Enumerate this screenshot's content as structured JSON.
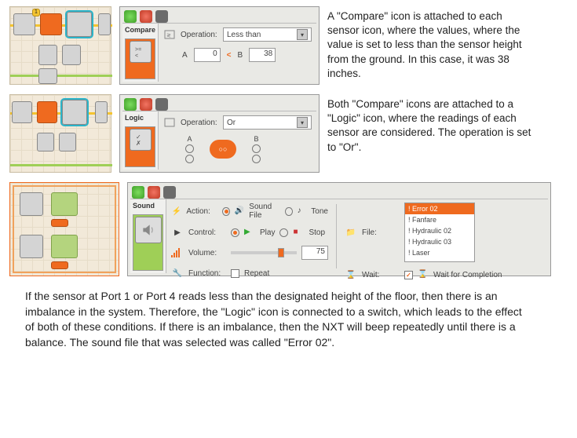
{
  "compare": {
    "panel_title": "Compare",
    "op_label": "Operation:",
    "op_value": "Less than",
    "a_label": "A",
    "a_value": "0",
    "b_label": "B",
    "b_value": "38",
    "caption": "A \"Compare\" icon is attached to each sensor icon, where the values, where the value is set to less than the sensor height from the ground. In this case, it was 38 inches."
  },
  "logic": {
    "panel_title": "Logic",
    "op_label": "Operation:",
    "op_value": "Or",
    "a_label": "A",
    "b_label": "B",
    "caption": "Both \"Compare\" icons are attached to a \"Logic\" icon, where the readings of each sensor are considered. The operation is set to \"Or\"."
  },
  "sound": {
    "panel_title": "Sound",
    "action_label": "Action:",
    "action_file": "Sound File",
    "action_tone": "Tone",
    "control_label": "Control:",
    "control_play": "Play",
    "control_stop": "Stop",
    "volume_label": "Volume:",
    "volume_value": "75",
    "function_label": "Function:",
    "function_repeat": "Repeat",
    "file_label": "File:",
    "file_items": [
      "! Error 02",
      "! Fanfare",
      "! Hydraulic 02",
      "! Hydraulic 03",
      "! Laser"
    ],
    "wait_label": "Wait:",
    "wait_value": "Wait for Completion"
  },
  "bottom_caption": "If the sensor at Port 1 or Port 4 reads less than the designated height of the floor, then there is an imbalance in the system. Therefore, the \"Logic\" icon is connected to a switch, which leads to the effect of both of these conditions. If there is an imbalance, then the NXT will beep repeatedly until there is a balance. The sound file that was selected was called \"Error 02\"."
}
